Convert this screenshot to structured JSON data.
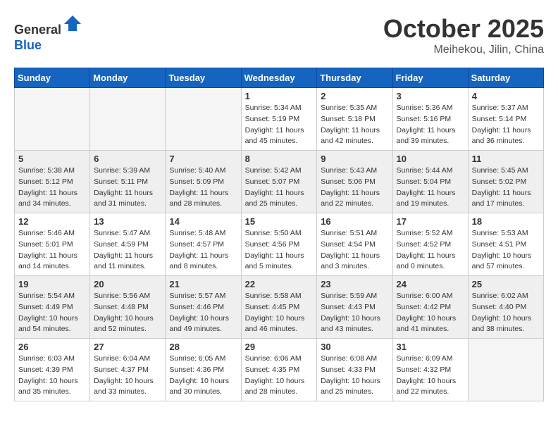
{
  "header": {
    "logo_line1": "General",
    "logo_line2": "Blue",
    "month": "October 2025",
    "location": "Meihekou, Jilin, China"
  },
  "weekdays": [
    "Sunday",
    "Monday",
    "Tuesday",
    "Wednesday",
    "Thursday",
    "Friday",
    "Saturday"
  ],
  "weeks": [
    [
      {
        "day": "",
        "detail": ""
      },
      {
        "day": "",
        "detail": ""
      },
      {
        "day": "",
        "detail": ""
      },
      {
        "day": "1",
        "detail": "Sunrise: 5:34 AM\nSunset: 5:19 PM\nDaylight: 11 hours and 45 minutes."
      },
      {
        "day": "2",
        "detail": "Sunrise: 5:35 AM\nSunset: 5:18 PM\nDaylight: 11 hours and 42 minutes."
      },
      {
        "day": "3",
        "detail": "Sunrise: 5:36 AM\nSunset: 5:16 PM\nDaylight: 11 hours and 39 minutes."
      },
      {
        "day": "4",
        "detail": "Sunrise: 5:37 AM\nSunset: 5:14 PM\nDaylight: 11 hours and 36 minutes."
      }
    ],
    [
      {
        "day": "5",
        "detail": "Sunrise: 5:38 AM\nSunset: 5:12 PM\nDaylight: 11 hours and 34 minutes."
      },
      {
        "day": "6",
        "detail": "Sunrise: 5:39 AM\nSunset: 5:11 PM\nDaylight: 11 hours and 31 minutes."
      },
      {
        "day": "7",
        "detail": "Sunrise: 5:40 AM\nSunset: 5:09 PM\nDaylight: 11 hours and 28 minutes."
      },
      {
        "day": "8",
        "detail": "Sunrise: 5:42 AM\nSunset: 5:07 PM\nDaylight: 11 hours and 25 minutes."
      },
      {
        "day": "9",
        "detail": "Sunrise: 5:43 AM\nSunset: 5:06 PM\nDaylight: 11 hours and 22 minutes."
      },
      {
        "day": "10",
        "detail": "Sunrise: 5:44 AM\nSunset: 5:04 PM\nDaylight: 11 hours and 19 minutes."
      },
      {
        "day": "11",
        "detail": "Sunrise: 5:45 AM\nSunset: 5:02 PM\nDaylight: 11 hours and 17 minutes."
      }
    ],
    [
      {
        "day": "12",
        "detail": "Sunrise: 5:46 AM\nSunset: 5:01 PM\nDaylight: 11 hours and 14 minutes."
      },
      {
        "day": "13",
        "detail": "Sunrise: 5:47 AM\nSunset: 4:59 PM\nDaylight: 11 hours and 11 minutes."
      },
      {
        "day": "14",
        "detail": "Sunrise: 5:48 AM\nSunset: 4:57 PM\nDaylight: 11 hours and 8 minutes."
      },
      {
        "day": "15",
        "detail": "Sunrise: 5:50 AM\nSunset: 4:56 PM\nDaylight: 11 hours and 5 minutes."
      },
      {
        "day": "16",
        "detail": "Sunrise: 5:51 AM\nSunset: 4:54 PM\nDaylight: 11 hours and 3 minutes."
      },
      {
        "day": "17",
        "detail": "Sunrise: 5:52 AM\nSunset: 4:52 PM\nDaylight: 11 hours and 0 minutes."
      },
      {
        "day": "18",
        "detail": "Sunrise: 5:53 AM\nSunset: 4:51 PM\nDaylight: 10 hours and 57 minutes."
      }
    ],
    [
      {
        "day": "19",
        "detail": "Sunrise: 5:54 AM\nSunset: 4:49 PM\nDaylight: 10 hours and 54 minutes."
      },
      {
        "day": "20",
        "detail": "Sunrise: 5:56 AM\nSunset: 4:48 PM\nDaylight: 10 hours and 52 minutes."
      },
      {
        "day": "21",
        "detail": "Sunrise: 5:57 AM\nSunset: 4:46 PM\nDaylight: 10 hours and 49 minutes."
      },
      {
        "day": "22",
        "detail": "Sunrise: 5:58 AM\nSunset: 4:45 PM\nDaylight: 10 hours and 46 minutes."
      },
      {
        "day": "23",
        "detail": "Sunrise: 5:59 AM\nSunset: 4:43 PM\nDaylight: 10 hours and 43 minutes."
      },
      {
        "day": "24",
        "detail": "Sunrise: 6:00 AM\nSunset: 4:42 PM\nDaylight: 10 hours and 41 minutes."
      },
      {
        "day": "25",
        "detail": "Sunrise: 6:02 AM\nSunset: 4:40 PM\nDaylight: 10 hours and 38 minutes."
      }
    ],
    [
      {
        "day": "26",
        "detail": "Sunrise: 6:03 AM\nSunset: 4:39 PM\nDaylight: 10 hours and 35 minutes."
      },
      {
        "day": "27",
        "detail": "Sunrise: 6:04 AM\nSunset: 4:37 PM\nDaylight: 10 hours and 33 minutes."
      },
      {
        "day": "28",
        "detail": "Sunrise: 6:05 AM\nSunset: 4:36 PM\nDaylight: 10 hours and 30 minutes."
      },
      {
        "day": "29",
        "detail": "Sunrise: 6:06 AM\nSunset: 4:35 PM\nDaylight: 10 hours and 28 minutes."
      },
      {
        "day": "30",
        "detail": "Sunrise: 6:08 AM\nSunset: 4:33 PM\nDaylight: 10 hours and 25 minutes."
      },
      {
        "day": "31",
        "detail": "Sunrise: 6:09 AM\nSunset: 4:32 PM\nDaylight: 10 hours and 22 minutes."
      },
      {
        "day": "",
        "detail": ""
      }
    ]
  ]
}
